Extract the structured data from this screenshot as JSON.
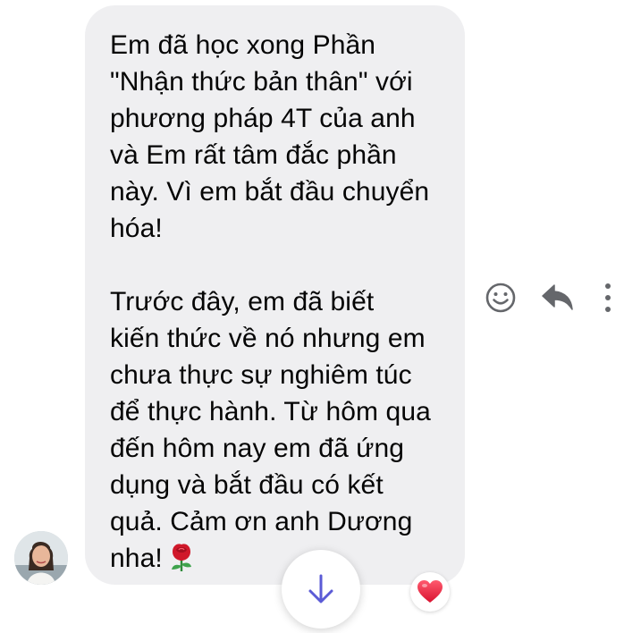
{
  "message": {
    "text": "Em đã học xong Phần\n\"Nhận thức bản thân\" với\nphương pháp 4T của anh\nvà Em rất tâm đắc phần\nnày. Vì em bắt đầu chuyển\nhóa!\n\nTrước đây, em đã biết\nkiến thức về nó nhưng em\nchưa thực sự nghiêm túc\nđể thực hành. Từ hôm qua\nđến hôm nay em đã ứng\ndụng và bắt đầu có kết\nquả. Cảm ơn anh Dương\nnha!",
    "emoji": "rose-icon",
    "reaction": "heart-icon"
  },
  "actions": [
    "smiley-icon",
    "reply-icon",
    "more-icon"
  ],
  "scroll_button": "arrow-down-icon",
  "colors": {
    "bubble": "#efeff1",
    "text": "#050505",
    "icon_gray": "#65676b",
    "accent": "#5b5bd6",
    "heart": "#e4283f"
  }
}
